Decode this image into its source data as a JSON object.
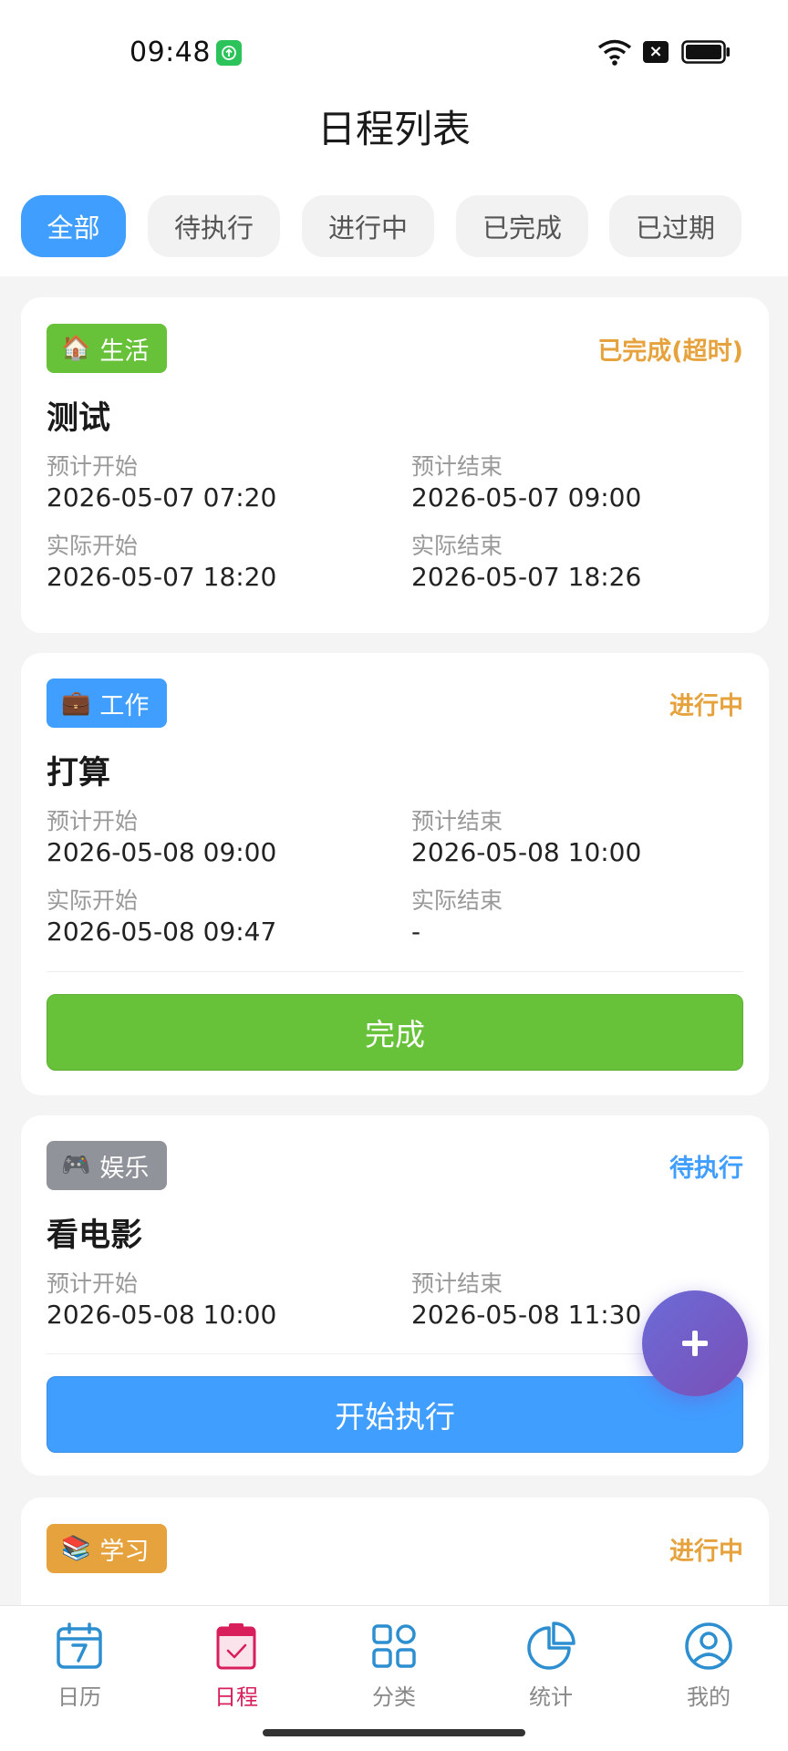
{
  "status_bar": {
    "time": "09:48"
  },
  "page_title": "日程列表",
  "filters": [
    {
      "label": "全部",
      "active": true
    },
    {
      "label": "待执行",
      "active": false
    },
    {
      "label": "进行中",
      "active": false
    },
    {
      "label": "已完成",
      "active": false
    },
    {
      "label": "已过期",
      "active": false
    }
  ],
  "schedules": [
    {
      "category": {
        "emoji": "🏠",
        "label": "生活",
        "color": "#67c23a"
      },
      "status": {
        "label": "已完成(超时)",
        "color": "#e6a23c"
      },
      "title": "测试",
      "planned_start_label": "预计开始",
      "planned_start": "2026-05-07 07:20",
      "planned_end_label": "预计结束",
      "planned_end": "2026-05-07 09:00",
      "actual_start_label": "实际开始",
      "actual_start": "2026-05-07 18:20",
      "actual_end_label": "实际结束",
      "actual_end": "2026-05-07 18:26"
    },
    {
      "category": {
        "emoji": "💼",
        "label": "工作",
        "color": "#409eff"
      },
      "status": {
        "label": "进行中",
        "color": "#e6a23c"
      },
      "title": "打算",
      "planned_start_label": "预计开始",
      "planned_start": "2026-05-08 09:00",
      "planned_end_label": "预计结束",
      "planned_end": "2026-05-08 10:00",
      "actual_start_label": "实际开始",
      "actual_start": "2026-05-08 09:47",
      "actual_end_label": "实际结束",
      "actual_end": "-",
      "action": {
        "label": "完成",
        "color": "#67c23a"
      }
    },
    {
      "category": {
        "emoji": "🎮",
        "label": "娱乐",
        "color": "#909399"
      },
      "status": {
        "label": "待执行",
        "color": "#409eff"
      },
      "title": "看电影",
      "planned_start_label": "预计开始",
      "planned_start": "2026-05-08 10:00",
      "planned_end_label": "预计结束",
      "planned_end": "2026-05-08 11:30",
      "action": {
        "label": "开始执行",
        "color": "#409eff"
      }
    },
    {
      "category": {
        "emoji": "📚",
        "label": "学习",
        "color": "#e6a23c"
      },
      "status": {
        "label": "进行中",
        "color": "#e6a23c"
      }
    }
  ],
  "fab": {
    "icon": "plus-icon"
  },
  "bottom_nav": [
    {
      "label": "日历",
      "icon": "calendar-icon",
      "active": false
    },
    {
      "label": "日程",
      "icon": "schedule-icon",
      "active": true
    },
    {
      "label": "分类",
      "icon": "category-icon",
      "active": false
    },
    {
      "label": "统计",
      "icon": "stats-icon",
      "active": false
    },
    {
      "label": "我的",
      "icon": "profile-icon",
      "active": false
    }
  ],
  "colors": {
    "primary": "#409eff",
    "success": "#67c23a",
    "warning": "#e6a23c",
    "info": "#909399",
    "nav_active": "#d81e5b"
  }
}
